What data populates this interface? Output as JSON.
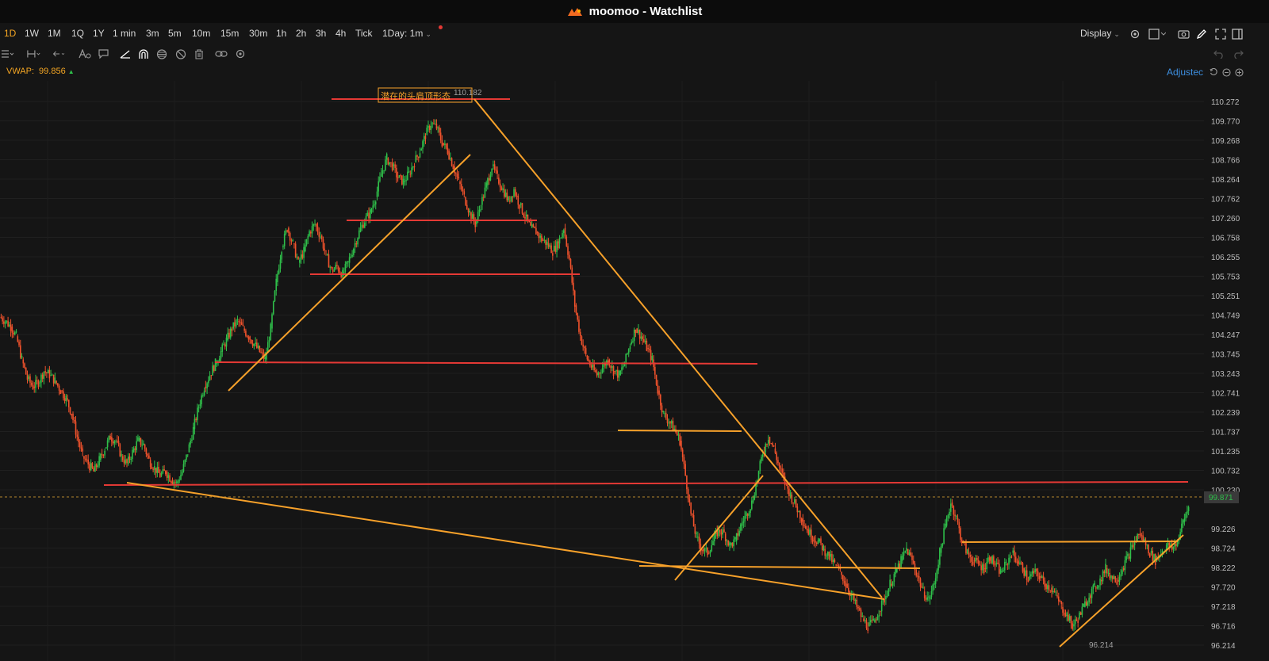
{
  "window": {
    "title": "moomoo - Watchlist"
  },
  "timeframes": {
    "items": [
      "1D",
      "1W",
      "1M",
      "1Q",
      "1Y",
      "1 min",
      "3m",
      "5m",
      "10m",
      "15m",
      "30m",
      "1h",
      "2h",
      "3h",
      "4h",
      "Tick"
    ],
    "active": "1D",
    "selector_label": "1Day: 1m"
  },
  "toolbar": {
    "display_label": "Display"
  },
  "indicator": {
    "name": "VWAP:",
    "value": "99.856"
  },
  "adjust_label": "Adjustec",
  "chart_data": {
    "type": "candlestick",
    "title": "",
    "yticks": [
      "110.272",
      "109.770",
      "109.268",
      "108.766",
      "108.264",
      "107.762",
      "107.260",
      "106.758",
      "106.255",
      "105.753",
      "105.251",
      "104.749",
      "104.247",
      "103.745",
      "103.243",
      "102.741",
      "102.239",
      "101.737",
      "101.235",
      "100.732",
      "100.230",
      "99.226",
      "98.724",
      "98.222",
      "97.720",
      "97.218",
      "96.716",
      "96.214"
    ],
    "ylim": [
      96.05,
      110.6
    ],
    "high_label": "110.182",
    "low_label": "96.214",
    "current_price": "99.871",
    "annotation": "潜在的头肩顶形态",
    "series": [
      {
        "close": [
          104.6,
          104.45,
          104.2,
          103.6,
          103.1,
          102.9,
          103.0,
          103.3,
          103.2,
          103.05,
          102.8,
          102.6,
          102.2,
          101.6,
          101.1,
          100.9,
          100.7,
          101.0,
          101.3,
          101.6,
          101.5,
          101.1,
          100.9,
          101.2,
          101.5,
          101.4,
          101.0,
          100.8,
          100.6,
          100.7,
          100.5,
          100.4,
          100.7,
          101.2,
          101.8,
          102.4,
          102.9,
          103.2,
          103.5,
          103.8,
          104.1,
          104.4,
          104.6,
          104.4,
          104.2,
          104.0,
          103.8,
          103.6,
          104.4,
          105.6,
          106.5,
          107.0,
          106.6,
          106.1,
          106.4,
          106.9,
          107.1,
          106.8,
          106.3,
          105.9,
          106.0,
          105.8,
          106.1,
          106.5,
          106.9,
          107.2,
          107.4,
          107.8,
          108.4,
          108.8,
          108.6,
          108.3,
          108.2,
          108.4,
          108.7,
          109.0,
          109.4,
          109.7,
          109.6,
          109.2,
          109.0,
          108.6,
          108.2,
          107.8,
          107.4,
          107.1,
          107.6,
          108.1,
          108.6,
          108.3,
          108.0,
          107.7,
          108.0,
          107.6,
          107.3,
          107.0,
          106.9,
          106.7,
          106.6,
          106.4,
          106.6,
          107.0,
          106.2,
          105.0,
          104.2,
          103.7,
          103.4,
          103.2,
          103.4,
          103.6,
          103.3,
          103.2,
          103.5,
          104.0,
          104.4,
          104.2,
          103.9,
          103.6,
          102.8,
          102.2,
          102.0,
          101.8,
          101.5,
          100.6,
          99.6,
          99.0,
          98.7,
          98.6,
          98.9,
          99.2,
          99.1,
          98.8,
          98.9,
          99.3,
          99.6,
          99.9,
          100.5,
          101.2,
          101.6,
          101.3,
          100.8,
          100.4,
          100.1,
          99.8,
          99.5,
          99.2,
          99.0,
          98.9,
          98.7,
          98.5,
          98.3,
          98.1,
          97.8,
          97.5,
          97.2,
          96.9,
          96.7,
          96.8,
          97.1,
          97.4,
          97.8,
          98.1,
          98.4,
          98.7,
          98.4,
          98.0,
          97.6,
          97.4,
          97.8,
          98.6,
          99.3,
          99.9,
          99.5,
          98.9,
          98.6,
          98.4,
          98.3,
          98.2,
          98.5,
          98.3,
          98.1,
          98.3,
          98.6,
          98.4,
          98.2,
          97.9,
          98.1,
          98.0,
          97.8,
          97.7,
          97.5,
          97.2,
          97.0,
          96.7,
          96.9,
          97.2,
          97.5,
          97.7,
          97.9,
          98.2,
          98.0,
          97.9,
          98.2,
          98.5,
          98.8,
          99.1,
          98.9,
          98.6,
          98.4,
          98.6,
          98.8,
          98.7,
          98.9,
          99.4,
          99.8
        ]
      }
    ]
  },
  "icons": [
    "moomoo-logo-icon",
    "settings-icon",
    "layout-icon",
    "camera-icon",
    "pen-icon",
    "fullscreen-icon",
    "sidebar-icon"
  ],
  "colors": {
    "accent": "#f5a623",
    "up": "#2fbf4a",
    "down": "#f0522c",
    "support_line": "#e53935",
    "trend_line": "#f7a12a",
    "link": "#3d8fe0"
  }
}
